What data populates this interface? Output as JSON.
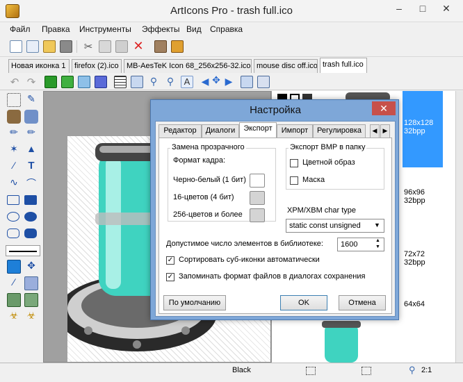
{
  "window": {
    "title": "ArtIcons Pro - trash full.ico"
  },
  "menu": [
    "Файл",
    "Правка",
    "Инструменты",
    "Эффекты",
    "Вид",
    "Справка"
  ],
  "doc_tabs": [
    {
      "label": "Новая иконка 1"
    },
    {
      "label": "firefox (2).ico"
    },
    {
      "label": "MB-AesTeK Icon 68_256x256-32.ico"
    },
    {
      "label": "mouse disc off.ico"
    },
    {
      "label": "trash full.ico"
    }
  ],
  "formats": [
    {
      "size": "128x128",
      "depth": "32bpp"
    },
    {
      "size": "96x96",
      "depth": "32bpp"
    },
    {
      "size": "72x72",
      "depth": "32bpp"
    },
    {
      "size": "64x64",
      "depth": ""
    }
  ],
  "status": {
    "color": "Black",
    "zoom": "2:1"
  },
  "dialog": {
    "title": "Настройка",
    "tabs": [
      "Редактор",
      "Диалоги",
      "Экспорт",
      "Импорт",
      "Регулировка"
    ],
    "transparency_group": "Замена прозрачного",
    "frame_format_label": "Формат кадра:",
    "rows": [
      {
        "label": "Черно-белый (1 бит)"
      },
      {
        "label": "16-цветов (4 бит)"
      },
      {
        "label": "256-цветов и более"
      }
    ],
    "bmp_group": "Экспорт BMP в папку",
    "bmp_color": "Цветной образ",
    "bmp_mask": "Маска",
    "xpm_label": "XPM/XBM char type",
    "xpm_value": "static const unsigned",
    "lib_label": "Допустимое число элементов в библиотеке:",
    "lib_value": "1600",
    "check_sort": "Сортировать суб-иконки автоматически",
    "check_remember": "Запоминать формат файлов в диалогах сохранения",
    "btn_default": "По умолчанию",
    "btn_ok": "OK",
    "btn_cancel": "Отмена"
  },
  "colors": {
    "accent": "#3399ff",
    "dialog_frame": "#7ea7d8",
    "close": "#c7504a",
    "teal": "#3fd3c0"
  }
}
